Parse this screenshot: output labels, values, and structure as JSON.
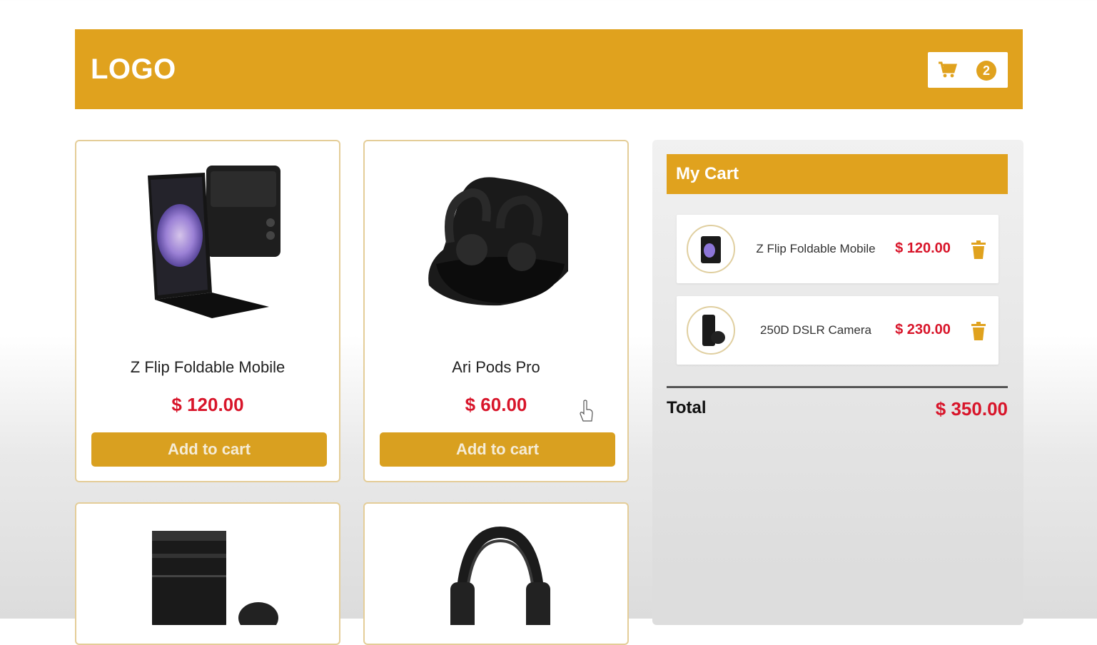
{
  "header": {
    "logo": "LOGO",
    "cart_count": "2",
    "cart_icon": "shopping-cart-icon",
    "accent_color": "#e0a21e"
  },
  "products": [
    {
      "name": "Z Flip Foldable Mobile",
      "price": "$ 120.00",
      "button": "Add to cart"
    },
    {
      "name": "Ari Pods Pro",
      "price": "$ 60.00",
      "button": "Add to cart"
    }
  ],
  "cart": {
    "title": "My Cart",
    "items": [
      {
        "name": "Z Flip Foldable Mobile",
        "price": "$ 120.00",
        "remove_icon": "trash-icon"
      },
      {
        "name": "250D DSLR Camera",
        "price": "$ 230.00",
        "remove_icon": "trash-icon"
      }
    ],
    "total_label": "Total",
    "total_value": "$ 350.00"
  },
  "colors": {
    "price_red": "#d8152a",
    "button_gold": "#d9a020"
  }
}
